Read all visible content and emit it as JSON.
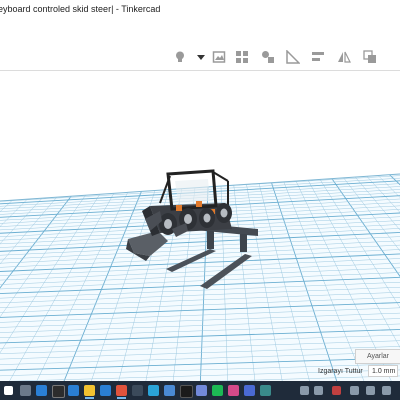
{
  "window": {
    "title": "eyboard controled skid steer| - Tinkercad"
  },
  "toolbar": {
    "icons": [
      "lightbulb-icon",
      "dropdown-arrow-icon",
      "image-icon",
      "blocks-icon",
      "shapes-icon",
      "triangle-ruler-icon",
      "align-icon",
      "mirror-icon",
      "group-icon"
    ]
  },
  "settings": {
    "label": "Ayarlar",
    "snap_grid_label": "Izgarayı Tuttur",
    "snap_grid_value": "1.0 mm"
  },
  "taskbar": {
    "apps": [
      "start",
      "search",
      "task-view",
      "folder",
      "chrome",
      "edge",
      "store",
      "mail",
      "photos",
      "settings",
      "steam",
      "discord",
      "music",
      "app",
      "app",
      "app",
      "app"
    ]
  },
  "colors": {
    "grid_line": "#9ec9e0",
    "grid_major": "#6aaed1",
    "taskbar": "#1f2b3a",
    "model_body": "#3c3f45",
    "model_accent": "#e07a2c"
  }
}
